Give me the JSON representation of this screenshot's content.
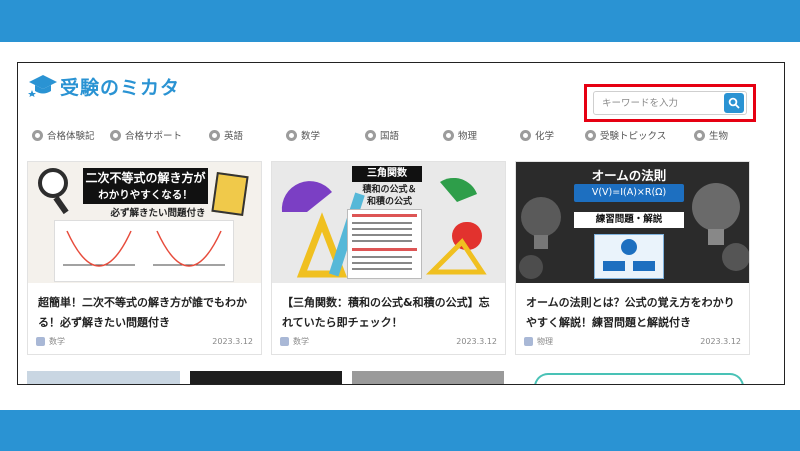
{
  "site": {
    "logo_text": "受験のミカタ"
  },
  "search": {
    "placeholder": "キーワードを入力",
    "highlight_color": "#e60012"
  },
  "nav": {
    "items": [
      {
        "label": "合格体験記",
        "icon": "trophy-icon"
      },
      {
        "label": "合格サポート",
        "icon": "support-icon"
      },
      {
        "label": "英語",
        "icon": "globe-icon"
      },
      {
        "label": "数学",
        "icon": "math-icon"
      },
      {
        "label": "国語",
        "icon": "book-icon"
      },
      {
        "label": "物理",
        "icon": "physics-icon"
      },
      {
        "label": "化学",
        "icon": "flask-icon"
      },
      {
        "label": "受験トピックス",
        "icon": "topics-icon"
      },
      {
        "label": "生物",
        "icon": "leaf-icon"
      }
    ]
  },
  "cards": [
    {
      "title": "超簡単！二次不等式の解き方が誰でもわかる！必ず解きたい問題付き",
      "category": "数学",
      "date": "2023.3.12",
      "thumb_text": {
        "line1": "二次不等式の解き方が",
        "line2": "わかりやすくなる！",
        "line3": "必ず解きたい問題付き"
      }
    },
    {
      "title": "【三角関数：積和の公式&和積の公式】忘れていたら即チェック！",
      "category": "数学",
      "date": "2023.3.12",
      "thumb_text": {
        "line1": "三角関数",
        "line2": "積和の公式＆",
        "line3": "和積の公式"
      }
    },
    {
      "title": "オームの法則とは？公式の覚え方をわかりやすく解説！練習問題と解説付き",
      "category": "物理",
      "date": "2023.3.12",
      "thumb_text": {
        "line1": "オームの法則",
        "line2": "V(V)=I(A)×R(Ω)",
        "line3": "練習問題・解説"
      }
    }
  ],
  "colors": {
    "brand_blue": "#2a93d3"
  }
}
